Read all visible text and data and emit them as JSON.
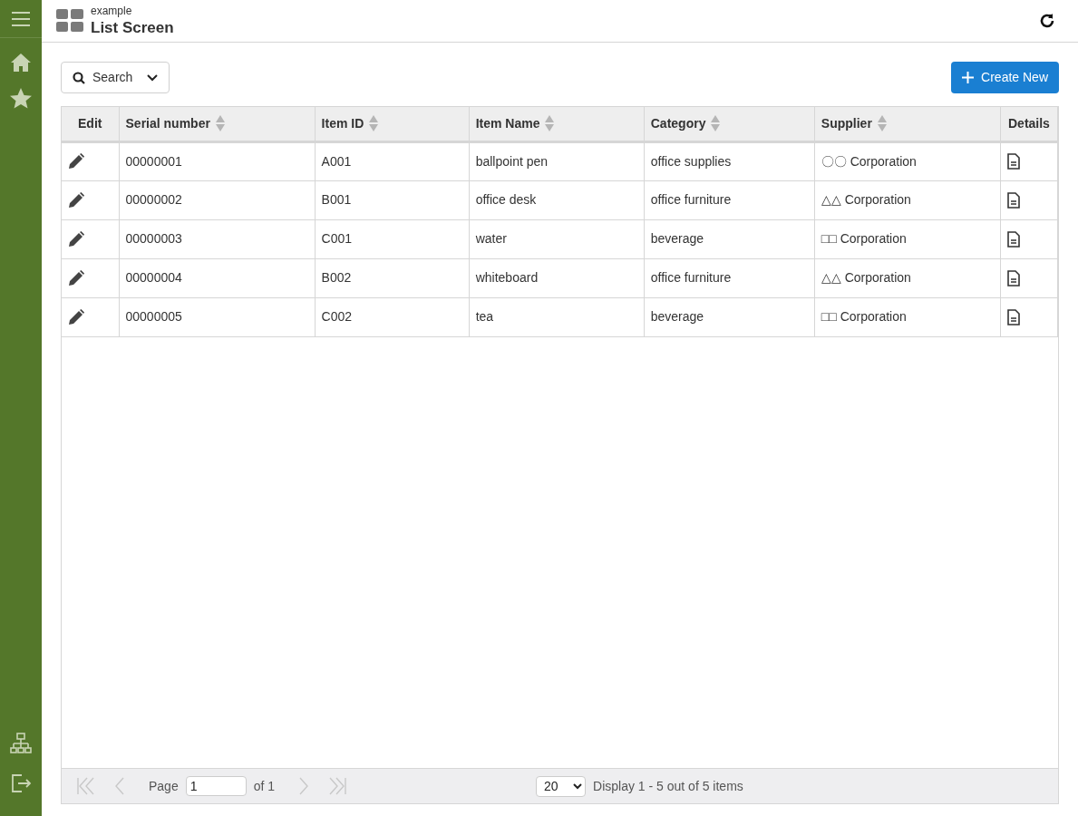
{
  "header": {
    "subtitle": "example",
    "title": "List Screen"
  },
  "toolbar": {
    "search_label": "Search",
    "create_label": "Create New"
  },
  "table": {
    "columns": [
      {
        "label": "Edit",
        "sortable": false,
        "kind": "edit"
      },
      {
        "label": "Serial number",
        "sortable": true,
        "kind": "text"
      },
      {
        "label": "Item ID",
        "sortable": true,
        "kind": "text"
      },
      {
        "label": "Item Name",
        "sortable": true,
        "kind": "text"
      },
      {
        "label": "Category",
        "sortable": true,
        "kind": "text"
      },
      {
        "label": "Supplier",
        "sortable": true,
        "kind": "text"
      },
      {
        "label": "Details",
        "sortable": false,
        "kind": "details"
      }
    ],
    "rows": [
      [
        "",
        "00000001",
        "A001",
        "ballpoint pen",
        "office supplies",
        "〇〇 Corporation",
        ""
      ],
      [
        "",
        "00000002",
        "B001",
        "office desk",
        "office furniture",
        "△△ Corporation",
        ""
      ],
      [
        "",
        "00000003",
        "C001",
        "water",
        "beverage",
        "□□ Corporation",
        ""
      ],
      [
        "",
        "00000004",
        "B002",
        "whiteboard",
        "office furniture",
        "△△ Corporation",
        ""
      ],
      [
        "",
        "00000005",
        "C002",
        "tea",
        "beverage",
        "□□ Corporation",
        ""
      ]
    ]
  },
  "pager": {
    "page_label": "Page",
    "page_value": "1",
    "of_label": "of 1",
    "first_disabled": true,
    "prev_disabled": true,
    "next_disabled": true,
    "last_disabled": true,
    "page_size": "20",
    "summary": "Display 1 - 5 out of 5 items"
  }
}
